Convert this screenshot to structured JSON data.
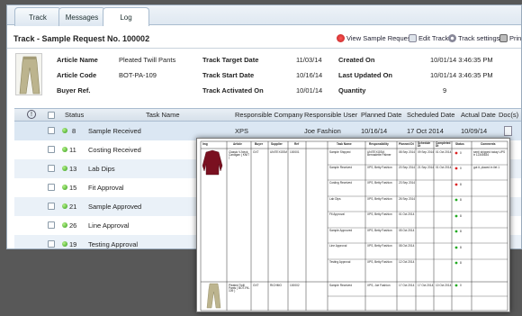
{
  "tabs": [
    {
      "label": "Track"
    },
    {
      "label": "Messages"
    },
    {
      "label": "Log"
    }
  ],
  "header": {
    "title": "Track - Sample Request No. 100002",
    "tools": {
      "view_sample": "View Sample Request",
      "edit_track": "Edit Track",
      "track_settings": "Track settings",
      "print": "Print"
    }
  },
  "info": {
    "article_name_label": "Article Name",
    "article_name": "Pleated Twill Pants",
    "article_code_label": "Article Code",
    "article_code": "BOT-PA-109",
    "buyer_ref_label": "Buyer Ref.",
    "buyer_ref": "",
    "target_date_label": "Track Target Date",
    "target_date": "11/03/14",
    "start_date_label": "Track Start Date",
    "start_date": "10/16/14",
    "activated_label": "Track Activated On",
    "activated": "10/01/14",
    "created_label": "Created On",
    "created": "10/01/14 3:46:35 PM",
    "updated_label": "Last Updated On",
    "updated": "10/01/14 3:46:35 PM",
    "quantity_label": "Quantity",
    "quantity": "9"
  },
  "table": {
    "columns": {
      "status": "Status",
      "task": "Task Name",
      "company": "Responsible Company",
      "user": "Responsible User",
      "planned": "Planned Date",
      "scheduled": "Scheduled Date",
      "actual": "Actual Date",
      "docs": "Doc(s)"
    },
    "rows": [
      {
        "num": "8",
        "task": "Sample Received",
        "company": "XPS",
        "user": "Joe Fashion",
        "planned": "10/16/14",
        "scheduled": "17 Oct 2014",
        "actual": "10/09/14"
      },
      {
        "num": "11",
        "task": "Costing Received",
        "company": "",
        "user": "",
        "planned": "",
        "scheduled": "",
        "actual": ""
      },
      {
        "num": "13",
        "task": "Lab Dips",
        "company": "",
        "user": "",
        "planned": "",
        "scheduled": "",
        "actual": ""
      },
      {
        "num": "15",
        "task": "Fit Approval",
        "company": "",
        "user": "",
        "planned": "",
        "scheduled": "",
        "actual": ""
      },
      {
        "num": "21",
        "task": "Sample Approved",
        "company": "",
        "user": "",
        "planned": "",
        "scheduled": "",
        "actual": ""
      },
      {
        "num": "26",
        "task": "Line Approval",
        "company": "",
        "user": "",
        "planned": "",
        "scheduled": "",
        "actual": ""
      },
      {
        "num": "19",
        "task": "Testing Approval",
        "company": "",
        "user": "",
        "planned": "",
        "scheduled": "",
        "actual": ""
      }
    ]
  },
  "report": {
    "headers": [
      "Img",
      "Article",
      "Buyer",
      "Supplier",
      "Ref",
      "Task Name",
      "Responsibility",
      "Planned Dt",
      "Schedule Dt",
      "Completed Dt",
      "Status",
      "Comments"
    ],
    "item1": {
      "article": "Classic V-Neck Cardigan ( KNIT )",
      "buyer": "GXT",
      "supplier": "UNITEXGSM",
      "ref": "100001"
    },
    "item2": {
      "article": "Pleated Twill Pants ( BOT-PA-109 )",
      "buyer": "GXT",
      "supplier": "RICHMO",
      "ref": "100002"
    },
    "tasks": [
      {
        "task": "Sample Shipped",
        "resp": "UNITEXGSM, Bernadette Palmer",
        "planned": "08 Sep 2014",
        "sched": "09 Sep 2014",
        "comp": "01 Oct 2014",
        "status": "0",
        "comment": "sent/ shipped today UPS tr 12345634"
      },
      {
        "task": "Sample Received",
        "resp": "XPS, Betty Fashion",
        "planned": "20 Sep 2014",
        "sched": "21 Sep 2014",
        "comp": "01 Oct 2014",
        "status": "0",
        "comment": "got it, placed in ilet 1"
      },
      {
        "task": "Costing Received",
        "resp": "XPS, Betty Fashion",
        "planned": "23 Sep 2014",
        "sched": "",
        "comp": "",
        "status": "8",
        "comment": ""
      },
      {
        "task": "Lab Dips",
        "resp": "XPS, Betty Fashion",
        "planned": "26 Sep 2014",
        "sched": "",
        "comp": "",
        "status": "8",
        "comment": ""
      },
      {
        "task": "Fit Approval",
        "resp": "XPS, Betty Fashion",
        "planned": "01 Oct 2014",
        "sched": "",
        "comp": "",
        "status": "8",
        "comment": ""
      },
      {
        "task": "Sample Approved",
        "resp": "XPS, Betty Fashion",
        "planned": "05 Oct 2014",
        "sched": "",
        "comp": "",
        "status": "8",
        "comment": ""
      },
      {
        "task": "Line Approval",
        "resp": "XPS, Betty Fashion",
        "planned": "08 Oct 2014",
        "sched": "",
        "comp": "",
        "status": "8",
        "comment": ""
      },
      {
        "task": "Testing Approval",
        "resp": "XPS, Betty Fashion",
        "planned": "12 Oct 2014",
        "sched": "",
        "comp": "",
        "status": "8",
        "comment": ""
      }
    ],
    "task2": {
      "task": "Sample Received",
      "resp": "XPS, Joe Fashion",
      "planned": "17 Oct 2014",
      "sched": "17 Oct 2014",
      "comp": "10 Oct 2014",
      "status": "0",
      "comment": ""
    }
  },
  "colors": {
    "accent": "#2f9a18",
    "header_bg": "#d6e0ea",
    "alt_row": "#eaf1f8"
  }
}
